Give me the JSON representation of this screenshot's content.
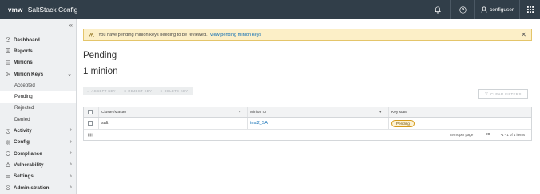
{
  "header": {
    "logo": "vmw",
    "title": "SaltStack Config",
    "icons": [
      "bell-icon",
      "help-icon",
      "user-icon",
      "apps-grid-icon"
    ],
    "user": "configuser"
  },
  "sidebar": {
    "collapse_glyph": "«",
    "items": [
      {
        "label": "Dashboard",
        "icon": "dashboard-icon"
      },
      {
        "label": "Reports",
        "icon": "reports-icon"
      },
      {
        "label": "Minions",
        "icon": "minions-icon"
      },
      {
        "label": "Minion Keys",
        "icon": "key-icon"
      }
    ],
    "sub_items": [
      "Accepted",
      "Pending",
      "Rejected",
      "Denied"
    ],
    "active_sub": "Pending",
    "lower_items": [
      {
        "label": "Activity",
        "icon": "activity-icon"
      },
      {
        "label": "Config",
        "icon": "config-icon"
      },
      {
        "label": "Compliance",
        "icon": "compliance-icon"
      },
      {
        "label": "Vulnerability",
        "icon": "vulnerability-icon"
      },
      {
        "label": "Settings",
        "icon": "settings-icon"
      },
      {
        "label": "Administration",
        "icon": "administration-icon"
      }
    ]
  },
  "alert": {
    "message": "You have pending minion keys needing to be reviewed.",
    "link": "View pending minion keys"
  },
  "main": {
    "title": "Pending",
    "count": "1 minion",
    "actions": [
      "ACCEPT KEY",
      "REJECT KEY",
      "DELETE KEY"
    ],
    "clear_filters": "CLEAR FILTERS"
  },
  "table": {
    "columns": [
      "Cluster/Master",
      "Minion ID",
      "Key state"
    ],
    "rows": [
      {
        "cluster": "salt",
        "minion_id": "test2_SA",
        "key_state": "Pending"
      }
    ],
    "items_per_page_label": "Items per page",
    "items_per_page": "20",
    "range": "1 - 1 of 1 items"
  },
  "colors": {
    "header_bg": "#313e49",
    "sidebar_bg": "#eef0f2",
    "alert_bg": "#fcefc7",
    "link": "#0a6bb3"
  }
}
